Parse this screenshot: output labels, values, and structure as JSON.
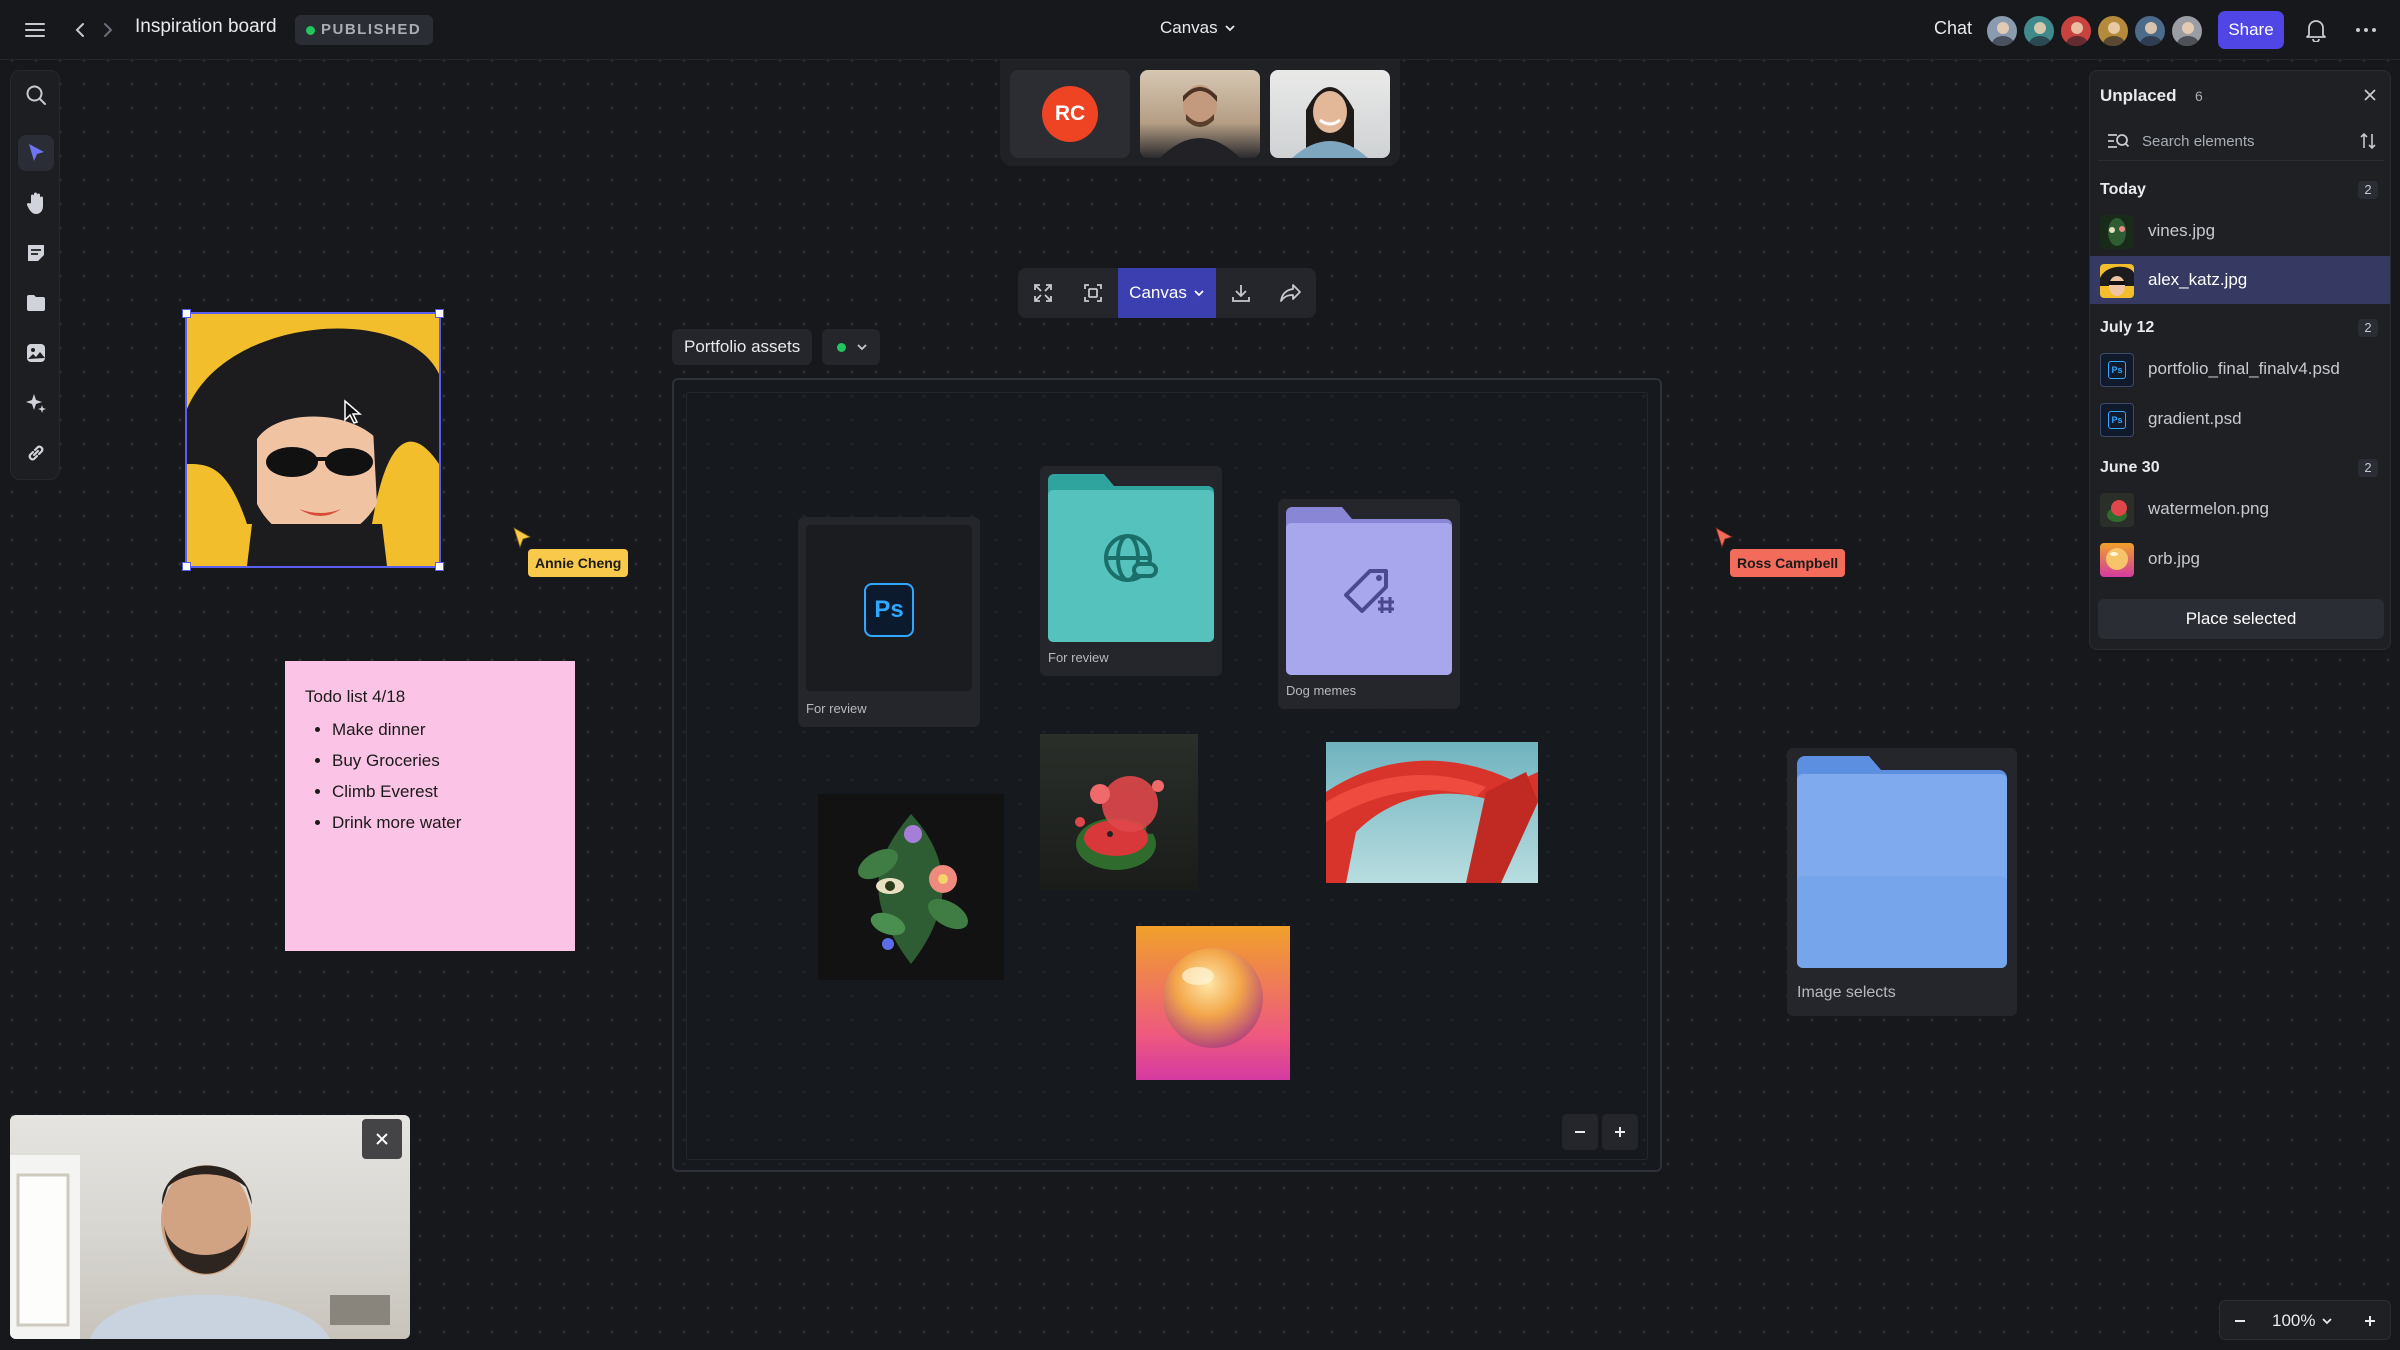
{
  "header": {
    "doc_title": "Inspiration board",
    "status_badge": "PUBLISHED",
    "view_menu": "Canvas",
    "chat_label": "Chat",
    "share_label": "Share",
    "collaborator_avatars": [
      "avatar-1",
      "avatar-2",
      "avatar-3",
      "avatar-4",
      "avatar-5",
      "avatar-6"
    ]
  },
  "toolbar": {
    "tools": [
      "search-icon",
      "pointer-icon",
      "hand-icon",
      "note-icon",
      "folder-icon",
      "image-icon",
      "sparkle-icon",
      "link-icon"
    ],
    "active_tool": "pointer-icon"
  },
  "call": {
    "participant_initials": "RC"
  },
  "canvas_toolbar": {
    "dropdown_label": "Canvas"
  },
  "frame": {
    "label": "Portfolio assets",
    "cards": [
      {
        "label": "For review"
      },
      {
        "label": "For review"
      },
      {
        "label": "Dog memes"
      }
    ]
  },
  "sticky": {
    "title": "Todo list 4/18",
    "items": [
      "Make dinner",
      "Buy Groceries",
      "Climb Everest",
      "Drink more water"
    ]
  },
  "cursors": {
    "annie": "Annie  Cheng",
    "ross": "Ross Campbell"
  },
  "folder_image_selects": {
    "label": "Image selects"
  },
  "panel": {
    "title": "Unplaced",
    "count": "6",
    "search_placeholder": "Search elements",
    "groups": [
      {
        "name": "Today",
        "count": "2",
        "files": [
          "vines.jpg",
          "alex_katz.jpg"
        ]
      },
      {
        "name": "July 12",
        "count": "2",
        "files": [
          "portfolio_final_finalv4.psd",
          "gradient.psd"
        ]
      },
      {
        "name": "June 30",
        "count": "2",
        "files": [
          "watermelon.png",
          "orb.jpg"
        ]
      }
    ],
    "selected_file": "alex_katz.jpg",
    "place_label": "Place selected"
  },
  "zoom": {
    "level": "100%"
  },
  "colors": {
    "accent": "#4f46e5",
    "canvas_dropdown": "#3b3fb0",
    "status_green": "#22c55e",
    "sticky": "#fbc3e5",
    "annie_cursor": "#f8c94a",
    "ross_cursor": "#f26b5b"
  }
}
